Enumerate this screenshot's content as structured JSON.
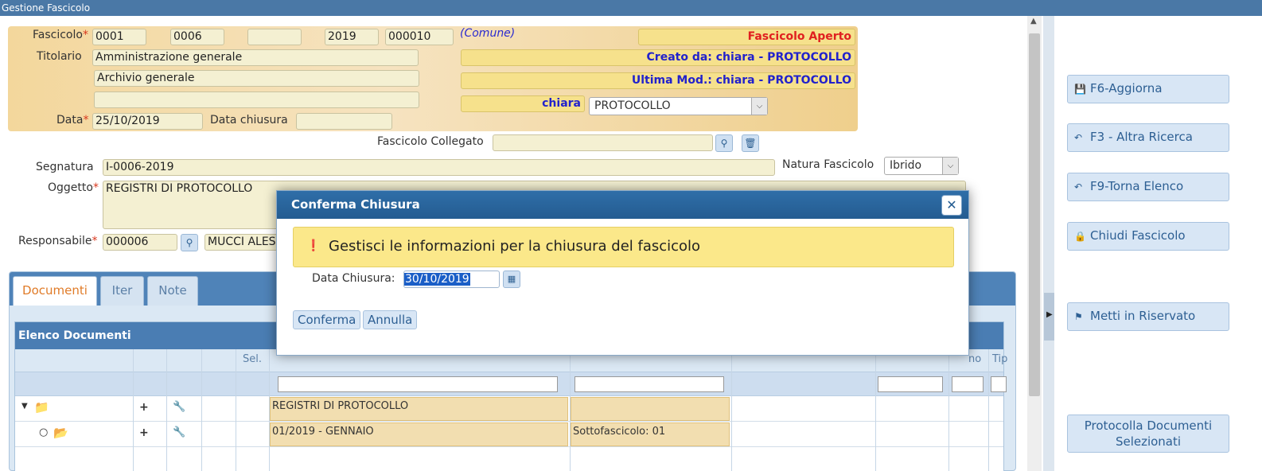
{
  "window": {
    "title": "Gestione Fascicolo"
  },
  "header": {
    "fascicolo_label": "Fascicolo",
    "fascicolo_fields": [
      "0001",
      "0006",
      "",
      "2019",
      "000010"
    ],
    "comune": "(Comune)",
    "status": "Fascicolo Aperto",
    "titolario_label": "Titolario",
    "titolario_1": "Amministrazione generale",
    "titolario_2": "Archivio generale",
    "titolario_3": "",
    "creato_da": "Creato da: chiara - PROTOCOLLO",
    "ultima_mod": "Ultima Mod.: chiara - PROTOCOLLO",
    "utente": "chiara",
    "ufficio_select": "PROTOCOLLO",
    "data_label": "Data",
    "data_value": "25/10/2019",
    "data_chiusura_label": "Data chiusura",
    "data_chiusura_value": ""
  },
  "form": {
    "fascicolo_collegato_label": "Fascicolo Collegato",
    "fascicolo_collegato_value": "",
    "segnatura_label": "Segnatura",
    "segnatura_value": "I-0006-2019",
    "natura_label": "Natura Fascicolo",
    "natura_value": "Ibrido",
    "oggetto_label": "Oggetto",
    "oggetto_value": "REGISTRI DI PROTOCOLLO",
    "responsabile_label": "Responsabile",
    "responsabile_code": "000006",
    "responsabile_name": "MUCCI ALESS"
  },
  "tabs": [
    {
      "label": "Documenti",
      "active": true
    },
    {
      "label": "Iter",
      "active": false
    },
    {
      "label": "Note",
      "active": false
    }
  ],
  "grid": {
    "title": "Elenco Documenti",
    "columns": {
      "sel": "Sel.",
      "anno_partial": "no",
      "tipo_partial": "Tip"
    },
    "rows": [
      {
        "plus": "+",
        "desc": "REGISTRI DI PROTOCOLLO",
        "sub": ""
      },
      {
        "plus": "+",
        "desc": "01/2019 - GENNAIO",
        "sub": "Sottofascicolo: 01"
      }
    ]
  },
  "sidebar": {
    "buttons": [
      {
        "icon": "save-icon",
        "label": "F6-Aggiorna"
      },
      {
        "icon": "back-icon",
        "label": "F3 - Altra Ricerca"
      },
      {
        "icon": "back-icon",
        "label": "F9-Torna Elenco"
      },
      {
        "icon": "lock-icon",
        "label": "Chiudi Fascicolo"
      },
      {
        "icon": "flag-icon",
        "label": "Metti in Riservato"
      },
      {
        "icon": "",
        "label": "Protocolla Documenti Selezionati"
      }
    ]
  },
  "modal": {
    "title": "Conferma Chiusura",
    "message": "Gestisci le informazioni per la chiusura del fascicolo",
    "date_label": "Data Chiusura:",
    "date_value": "30/10/2019",
    "confirm": "Conferma",
    "cancel": "Annulla"
  },
  "colors": {
    "titlebar": "#4a78a6",
    "status_red": "#e02020",
    "info_blue": "#2222cc",
    "tab_active": "#e07b28",
    "notice_yellow": "#fbe88a"
  }
}
